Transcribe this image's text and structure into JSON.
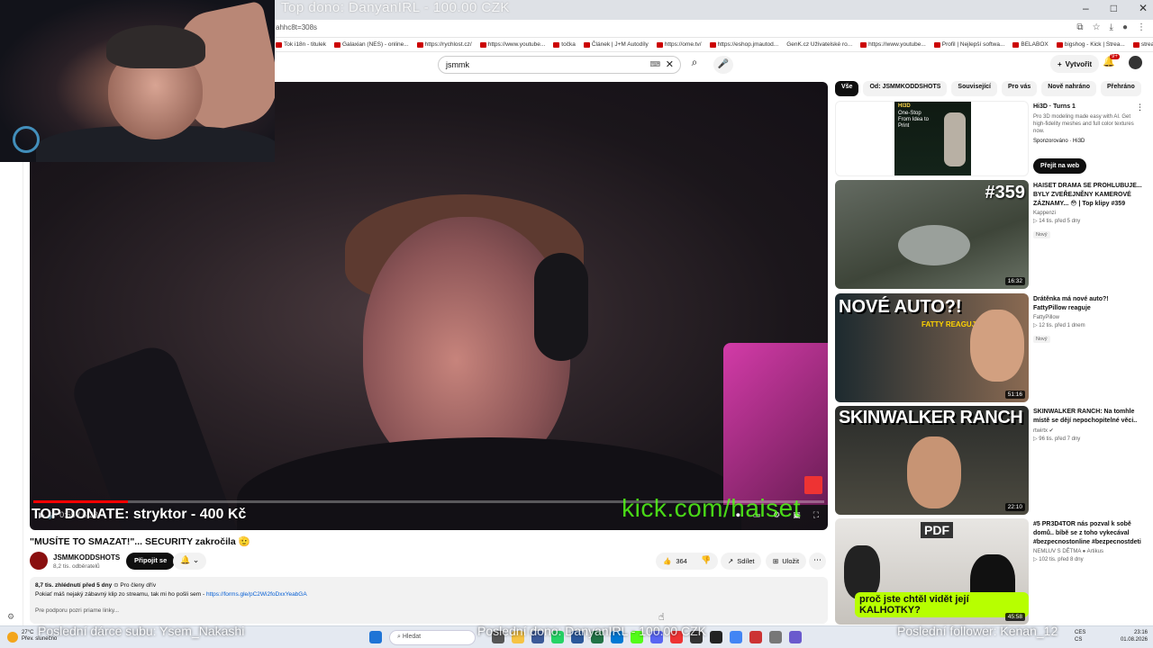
{
  "overlay": {
    "top_donor": "Top dono: DanyanIRL - 100.00 CZK",
    "top_donate": "TOP DONATE: stryktor - 400 Kč",
    "kick": "kick.com/haiset",
    "last_sub": "Poslední dárce subu: Ysem_Nakashi",
    "last_dono": "Poslední dono: DanyanIRL - 100.00 CZK",
    "last_follower": "Poslední follower: Kenan_12"
  },
  "browser": {
    "url": "ahhc8t=308s",
    "bookmarks": [
      "Tok i18n - titulek",
      "Galaxian (NES) - online...",
      "https://rychlost.cz/",
      "https://www.youtube...",
      "točka",
      "Článek | J+M Autodíly",
      "https://ome.tv/",
      "https://eshop.jmautod...",
      "GenK.cz Uživatelské ro...",
      "https://www.youtube...",
      "Profil | Nejlepší softwa...",
      "BELABOX",
      "bigshog - Kick | Strea...",
      "stream",
      "gpt"
    ]
  },
  "header": {
    "search_value": "jsmmk",
    "create_label": "Vytvořit",
    "notif_count": "9+"
  },
  "video": {
    "progress": 0.12,
    "time": "0:55 / 6:23",
    "title": "\"MUSÍTE TO SMAZAT!\"... SECURITY zakročila 🫡",
    "channel": "JSMMKODDSHOTS",
    "subs": "8,2 tis. odběratelů",
    "join_label": "Připojit se",
    "likes": "364",
    "share_label": "Sdílet",
    "save_label": "Uložit"
  },
  "description": {
    "meta": "8,7 tis. zhlédnutí  před 5 dny",
    "members": "Pro členy dřív",
    "line": "Pokiať máš nejaký zábavný klip zo streamu, tak mi ho pošli sem - ",
    "link": "https://forms.gle/pC2Wi2foDxxYeabGA",
    "line3": "Pre podporu pozri priame linky..."
  },
  "chips": [
    "Vše",
    "Od: JSMMKODDSHOTS",
    "Související",
    "Pro vás",
    "Nově nahráno",
    "Přehráno"
  ],
  "ad": {
    "title": "Hi3D · Turns 1",
    "desc": "Pro 3D modeling made easy with AI. Get high-fidelity meshes and full color textures now.",
    "sponsor": "Sponzorováno · Hi3D",
    "button": "Přejít na web",
    "thumb_brand": "HI3D",
    "thumb_text": "One-Stop From Idea to Print"
  },
  "recs": [
    {
      "title": "HAISET DRAMA SE PROHLUBUJE... BYLY ZVEŘEJNĚNY KAMEROVÉ ZÁZNAMY... 😳 | Top klipy #359",
      "channel": "Kappenzi",
      "meta": "14 tis.  před 5 dny",
      "badge": "Nový",
      "duration": "16:32",
      "thumb_text": "#359"
    },
    {
      "title": "Drátěnka má nové auto?! FattyPillow reaguje",
      "channel": "FattyPillow",
      "meta": "12 tis.  před 1 dnem",
      "badge": "Nový",
      "duration": "51:16",
      "thumb_text": "NOVÉ AUTO?!",
      "thumb_sub": "FATTY REAGUJE"
    },
    {
      "title": "SKINWALKER RANCH: Na tomhle místě se dějí nepochopitelné věci..",
      "channel": "rtwirtx",
      "meta": "96 tis.  před 7 dny",
      "badge": "",
      "duration": "22:10",
      "thumb_text": "SKINWALKER RANCH"
    },
    {
      "title": "#5 PR3D4TOR nás pozval k sobě domů.. bíbě se z toho vykecával #bezpecnostonline #bezpecnostdeti",
      "channel": "NEMLUV S DĚTMA ● Artikus",
      "meta": "102 tis.  před 8 dny",
      "badge": "",
      "duration": "45:58",
      "thumb_text": "PDF",
      "thumb_sub": "proč jste chtěl vidět její KALHOTKY?"
    }
  ],
  "taskbar": {
    "temp": "27°C",
    "weather": "Přev. slunečno",
    "search": "Hledat",
    "lang1": "CES",
    "lang2": "CS",
    "time": "23:16",
    "date": "01.08.2026"
  }
}
